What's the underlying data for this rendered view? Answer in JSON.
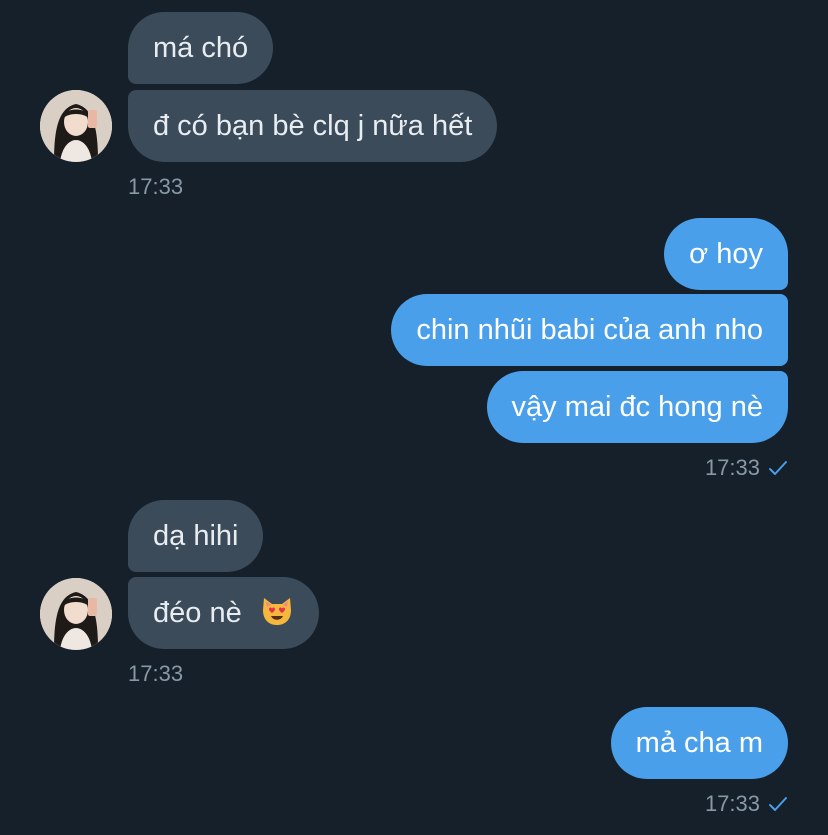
{
  "conversation": {
    "groups": [
      {
        "sender": "them",
        "messages": [
          "má chó",
          "đ có bạn bè clq j nữa hết"
        ],
        "timestamp": "17:33"
      },
      {
        "sender": "me",
        "messages": [
          "ơ hoy",
          "chin nhũi babi của anh nho",
          "vậy mai đc hong nè"
        ],
        "timestamp": "17:33",
        "read_indicator": "check-icon"
      },
      {
        "sender": "them",
        "messages": [
          "dạ hihi",
          "đéo nè"
        ],
        "emoji": "smiling-cat-heart-eyes-emoji",
        "timestamp": "17:33"
      },
      {
        "sender": "me",
        "messages": [
          "mả cha m"
        ],
        "timestamp": "17:33",
        "read_indicator": "check-icon"
      }
    ]
  },
  "colors": {
    "background": "#15202b",
    "incoming_bubble": "#3b4b59",
    "outgoing_bubble": "#4a9fea",
    "timestamp": "#8899a6",
    "check": "#4a9fea"
  }
}
